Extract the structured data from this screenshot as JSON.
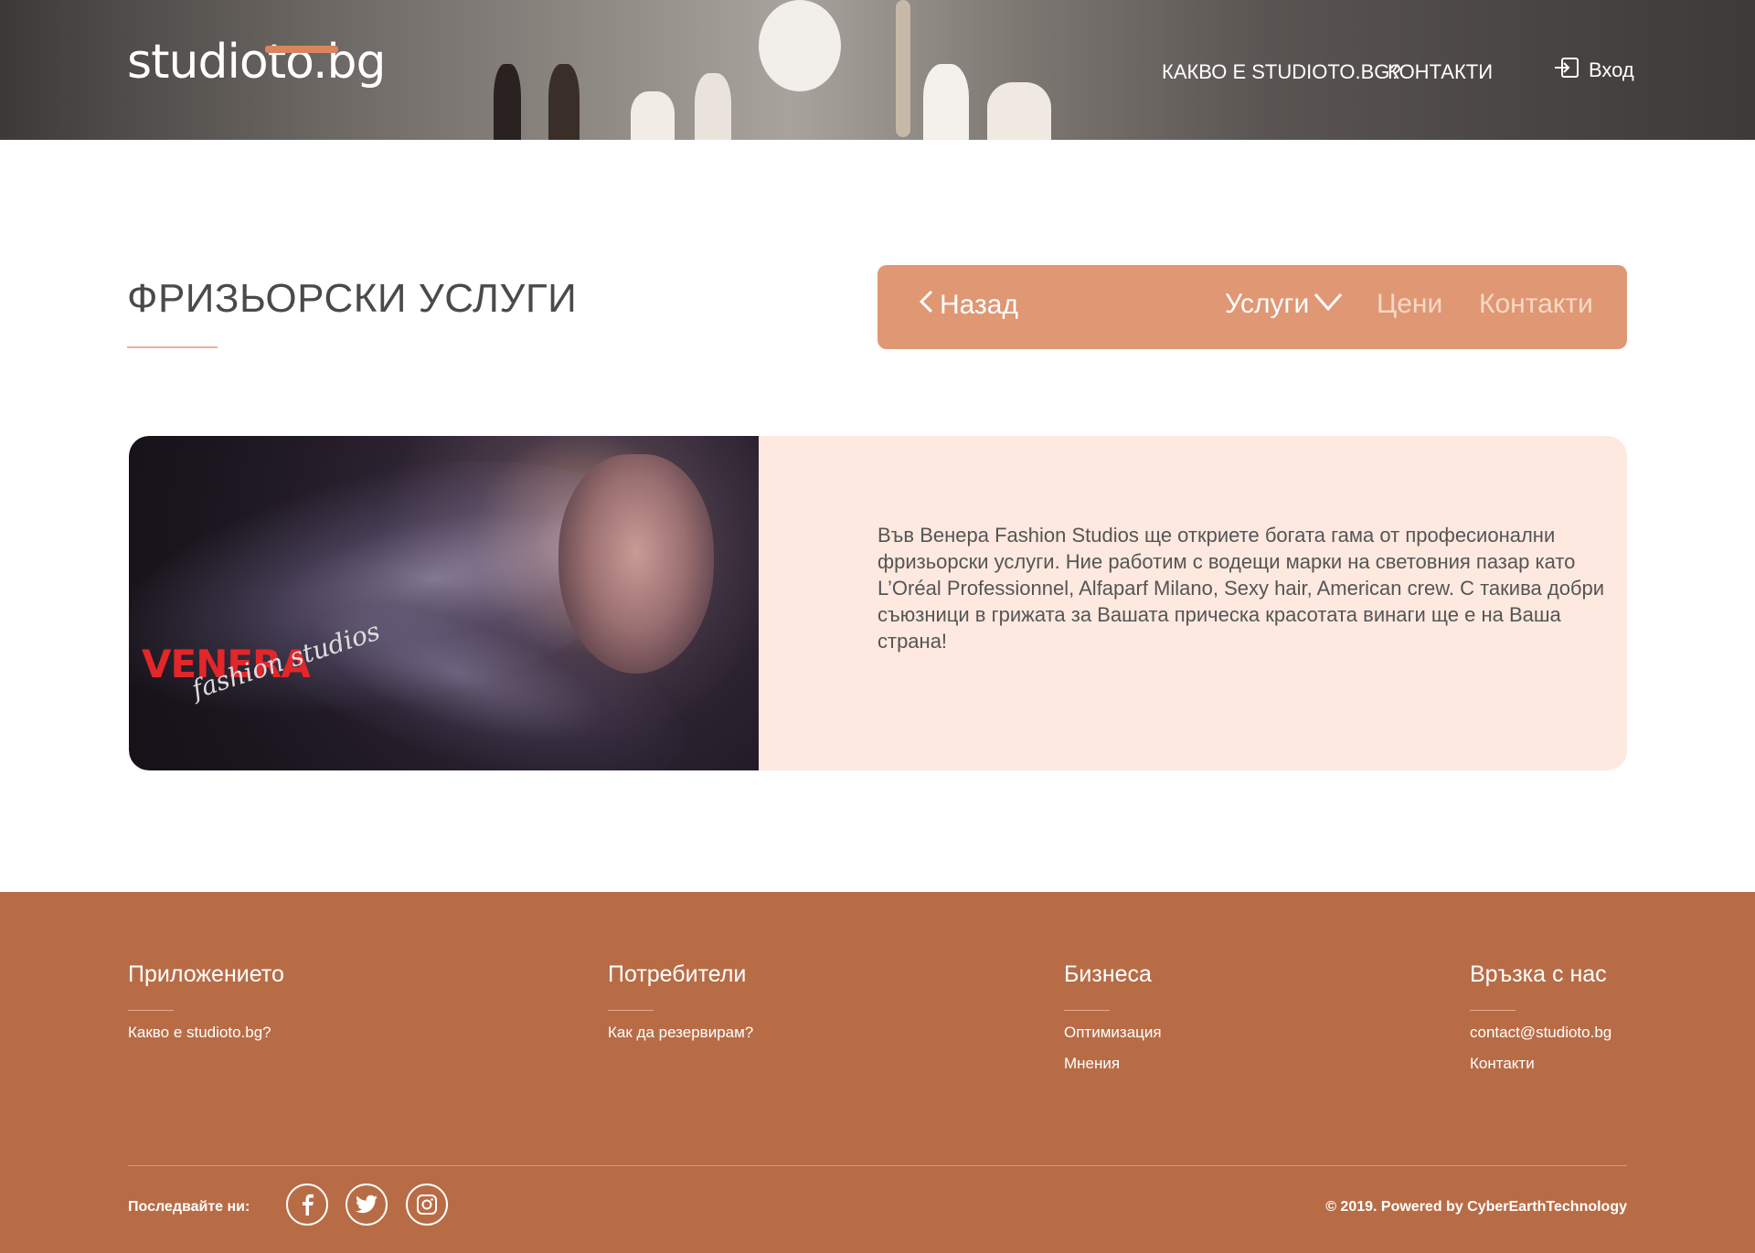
{
  "header": {
    "logo": "studioto.bg",
    "nav": [
      "КАКВО Е STUDIOTO.BG?",
      "КОНТАКТИ"
    ],
    "login": "Вход",
    "icons": {
      "login": "login-icon"
    }
  },
  "page": {
    "title": "ФРИЗЬОРСКИ УСЛУГИ"
  },
  "subnav": {
    "back": "Назад",
    "services": "Услуги",
    "prices": "Цени",
    "contacts": "Контакти",
    "color": "#e09773"
  },
  "card": {
    "image_logo": "VENERA",
    "image_tagline": "fashion studios",
    "text": "Във Венера Fashion Studios ще откриете богата гама от професионални фризьорски услуги. Ние работим с водещи марки на световния пазар като L’Oréal Professionnel, Alfaparf Milano, Sexy hair, American crew. С такива добри съюзници в грижата за Вашата прическа красотата винаги ще е на Ваша страна!",
    "background": "#fde9df"
  },
  "footer": {
    "background": "#b86c46",
    "columns": [
      {
        "title": "Приложението",
        "links": [
          "Какво е studioto.bg?"
        ]
      },
      {
        "title": "Потребители",
        "links": [
          "Как да резервирам?"
        ]
      },
      {
        "title": "Бизнеса",
        "links": [
          "Оптимизация",
          "Мнения"
        ]
      },
      {
        "title": "Връзка с нас",
        "links": [
          "contact@studioto.bg",
          "Контакти"
        ]
      }
    ],
    "follow": "Последвайте ни:",
    "social": [
      "facebook-icon",
      "twitter-icon",
      "instagram-icon"
    ],
    "copyright": "© 2019. Powered by CyberEarthTechnology"
  }
}
